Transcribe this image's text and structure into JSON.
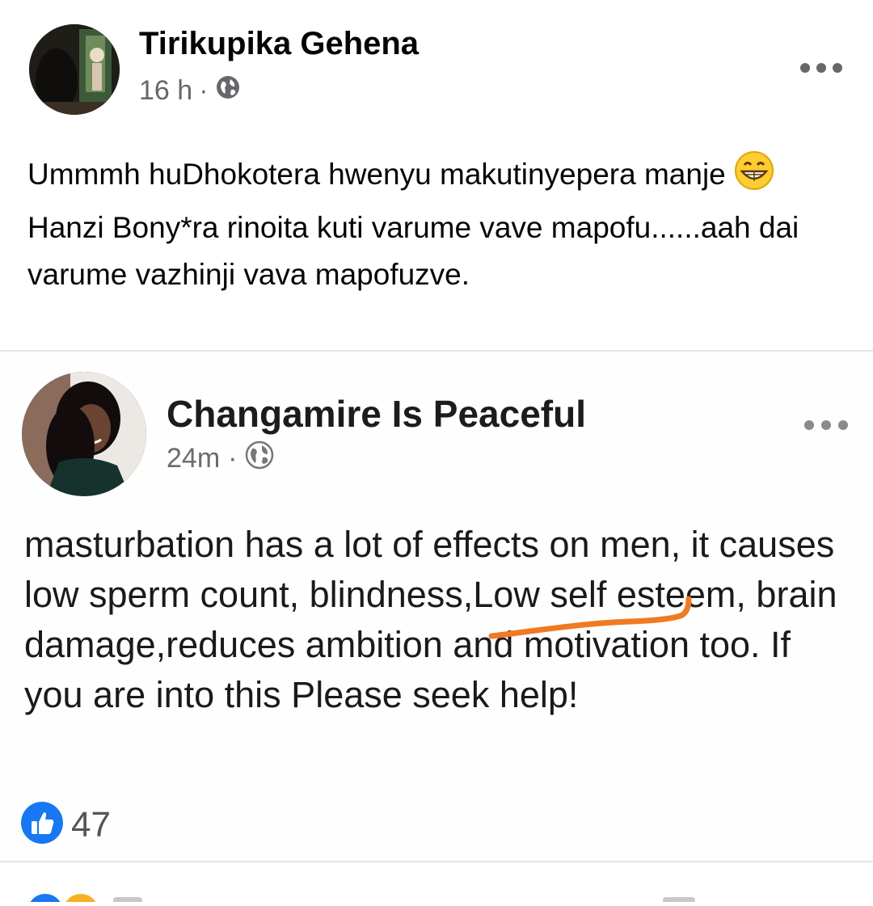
{
  "post": {
    "author": "Tirikupika Gehena",
    "time": "16 h",
    "separator": "·",
    "privacy_icon": "globe-icon",
    "text_before_emoji": "Ummmh huDhokotera hwenyu makutinyepera manje ",
    "emoji": "grinning-face-emoji",
    "text_after_emoji": "Hanzi Bony*ra rinoita kuti varume vave mapofu......aah dai varume vazhinji vava mapofuzve."
  },
  "shared_post": {
    "author": "Changamire Is Peaceful",
    "time": "24m",
    "separator": "·",
    "privacy_icon": "globe-icon",
    "text": "masturbation has a lot of effects on men, it causes low sperm count, blindness,Low self esteem, brain damage,reduces ambition and motivation too. If you are into this Please seek help!",
    "reactions": {
      "icon": "like-icon",
      "count": "47"
    }
  },
  "colors": {
    "accent": "#1877f2",
    "underline": "#f07a22",
    "meta": "#65676b"
  }
}
